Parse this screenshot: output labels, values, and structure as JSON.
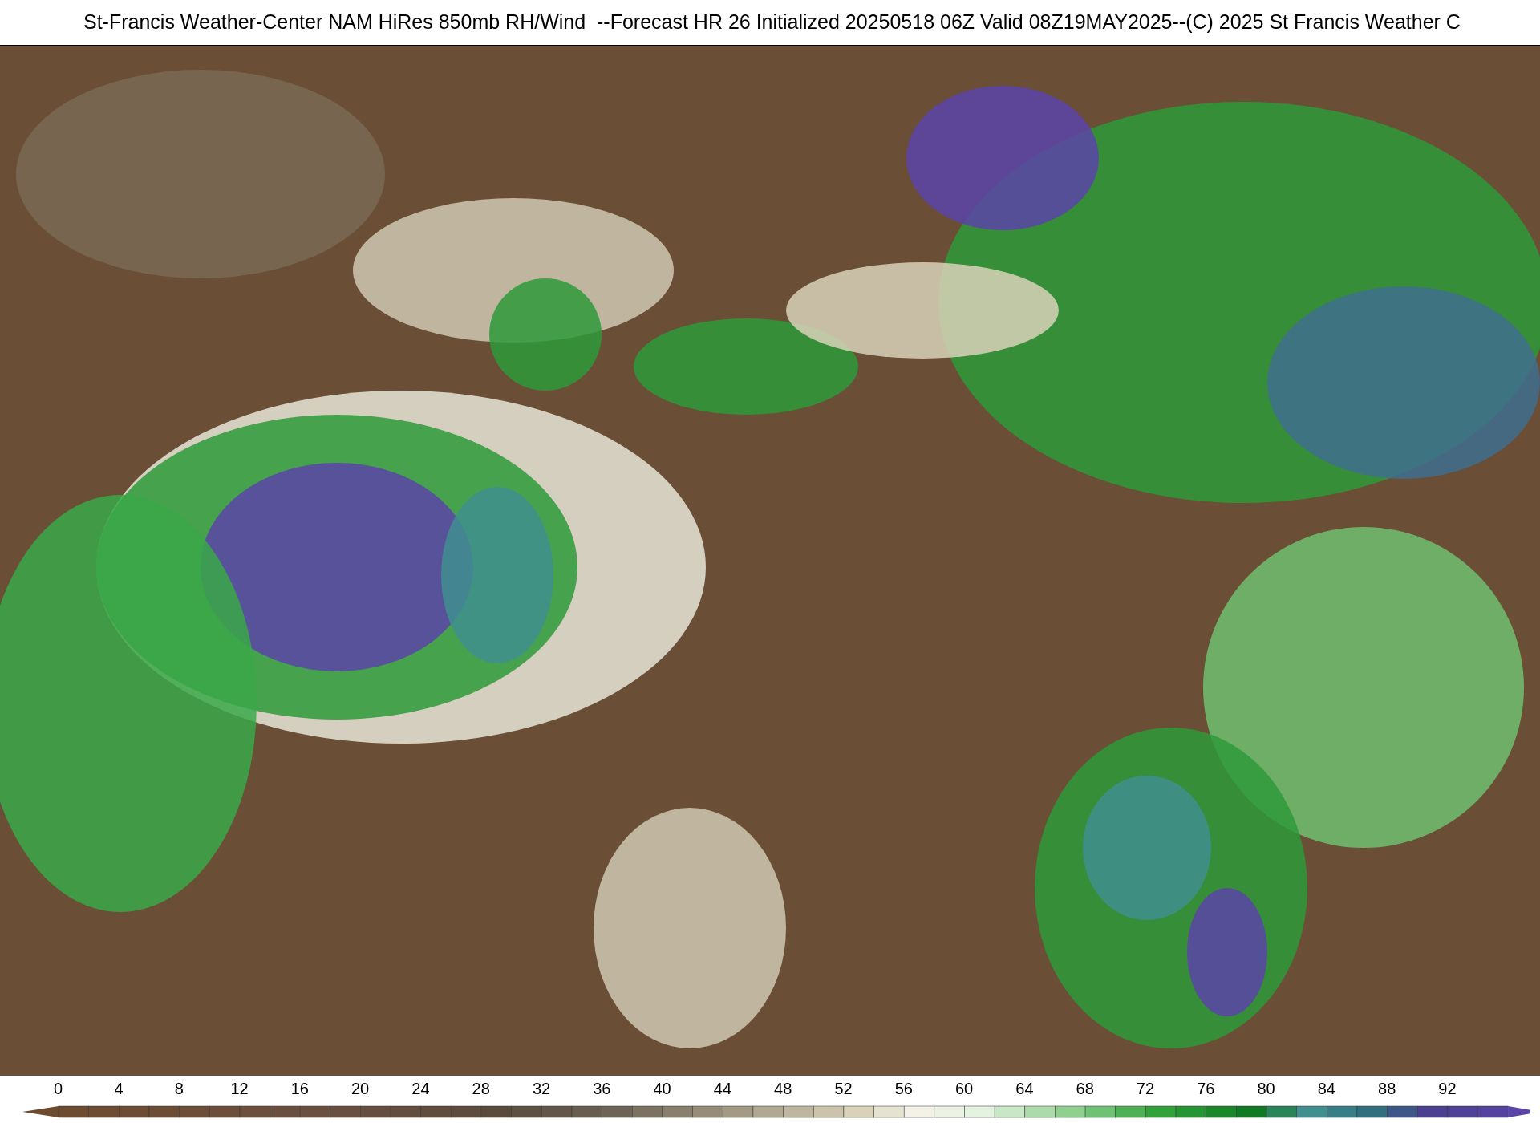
{
  "title": "St-Francis Weather-Center NAM HiRes 850mb RH/Wind  --Forecast HR 26 Initialized 20250518 06Z Valid 08Z19MAY2025--(C) 2025 St Francis Weather C",
  "colorbar": {
    "ticks": [
      "0",
      "4",
      "8",
      "12",
      "16",
      "20",
      "24",
      "28",
      "32",
      "36",
      "40",
      "44",
      "48",
      "52",
      "56",
      "60",
      "64",
      "68",
      "72",
      "76",
      "80",
      "84",
      "88",
      "92"
    ]
  }
}
